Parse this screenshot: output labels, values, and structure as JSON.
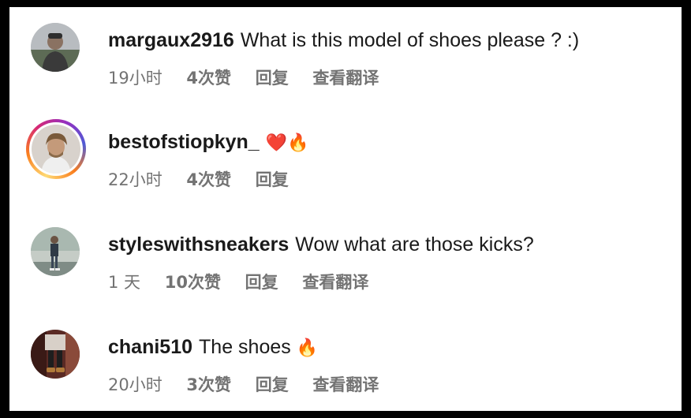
{
  "comments": [
    {
      "username": "margaux2916",
      "text": "What is this model of shoes please ? :)",
      "emoji": "",
      "time": "19小时",
      "likes": "4次赞",
      "reply": "回复",
      "translate": "查看翻译"
    },
    {
      "username": "bestofstiopkyn_",
      "text": "",
      "emoji": "❤️🔥",
      "time": "22小时",
      "likes": "4次赞",
      "reply": "回复",
      "translate": ""
    },
    {
      "username": "styleswithsneakers",
      "text": "Wow what are those kicks?",
      "emoji": "",
      "time": "1 天",
      "likes": "10次赞",
      "reply": "回复",
      "translate": "查看翻译"
    },
    {
      "username": "chani510",
      "text": "The shoes",
      "emoji": "🔥",
      "time": "20小时",
      "likes": "3次赞",
      "reply": "回复",
      "translate": "查看翻译"
    }
  ],
  "colors": {
    "text": "#1a1a1a",
    "meta": "#737373",
    "background": "#ffffff"
  }
}
